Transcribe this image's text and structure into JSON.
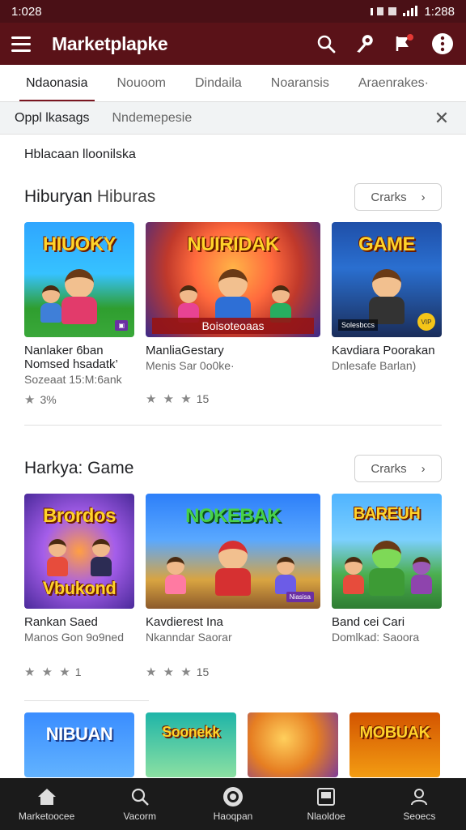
{
  "status": {
    "time_left": "1:028",
    "time_right": "1:288"
  },
  "app": {
    "title": "Marketplapke"
  },
  "icons": {
    "menu": "menu-icon",
    "search": "search-icon",
    "key": "key-icon",
    "flag": "flag-icon",
    "more": "more-vert-icon"
  },
  "tabs": [
    {
      "label": "Ndaonasia",
      "active": true
    },
    {
      "label": "Nouoom"
    },
    {
      "label": "Dindaila"
    },
    {
      "label": "Noaransis"
    },
    {
      "label": "Araenrakes·"
    }
  ],
  "filter": {
    "chip": "Oppl lkasags",
    "secondary": "Nndemepesie"
  },
  "subhead": "Hblacaan lloonilska",
  "sections": [
    {
      "title_bold": "Hiburyan",
      "title_rest": " Hiburas",
      "more_label": "Crarks",
      "cards": [
        {
          "thumb_title": "HIUOKY",
          "name": "Nanlaker 6ban",
          "name2": "Nomsed hsadatk’",
          "sub": "Sozeaat 15:M:6ank",
          "stars": "★ ",
          "rating": "3%",
          "badge": ""
        },
        {
          "thumb_title": "NUIRIDAK",
          "banner": "Boisoteoaas",
          "name": "ManliaGestary",
          "sub": "Menis Sar 0o0ke·",
          "stars": "★ ★ ★",
          "rating": "15"
        },
        {
          "thumb_title": "GAME",
          "chip": "Solesbccs",
          "coin": "VIP",
          "name": "Kavdiara Poorakan",
          "sub": "Dnlesafe Barlan)"
        }
      ]
    },
    {
      "title": "Harkya: Game",
      "more_label": "Crarks",
      "cards": [
        {
          "thumb_title": "Brordos",
          "thumb_title2": "Vbukond",
          "name": "Rankan Saed",
          "sub": "Manos Gon 9o9ned",
          "stars": "★ ★ ★",
          "rating": "1"
        },
        {
          "thumb_title": "NOKEBAK",
          "badge": "Niasisa",
          "name": "Kavdierest Ina",
          "sub": "Nkanndar Saorar",
          "stars": "★ ★ ★",
          "rating": "15"
        },
        {
          "thumb_title": "BAREUH",
          "name": "Band cei Cari",
          "sub": "Domlkad: Saoora"
        }
      ]
    }
  ],
  "third_row": [
    {
      "thumb_title": "NIBUAN"
    },
    {
      "thumb_title": "Soonekk"
    },
    {
      "thumb_title": ""
    },
    {
      "thumb_title": "MOBUAK"
    }
  ],
  "bottom_nav": [
    {
      "label": "Marketoocee",
      "icon": "home-icon"
    },
    {
      "label": "Vacorm",
      "icon": "search-icon"
    },
    {
      "label": "Haoqpan",
      "icon": "target-icon"
    },
    {
      "label": "Nlaoldoe",
      "icon": "library-icon"
    },
    {
      "label": "Seoecs",
      "icon": "profile-icon"
    }
  ]
}
